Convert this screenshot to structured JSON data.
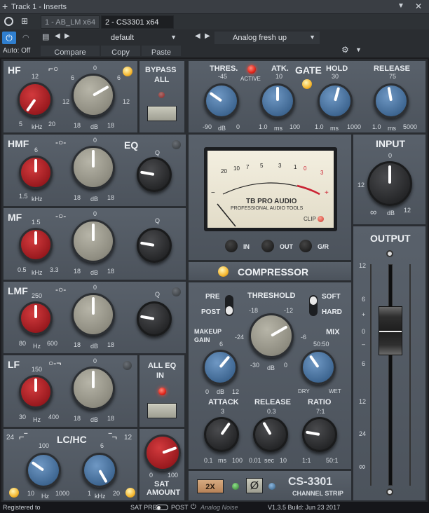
{
  "titlebar": {
    "title": "Track 1 - Inserts"
  },
  "tabs": [
    {
      "label": "1 - AB_LM x64"
    },
    {
      "label": "2 - CS3301 x64"
    }
  ],
  "preset": {
    "name": "default",
    "program": "Analog fresh up",
    "auto": "Auto: Off",
    "compare": "Compare",
    "copy": "Copy",
    "paste": "Paste"
  },
  "eq": {
    "hf": {
      "title": "HF",
      "freq_top": "12",
      "freq_lo": "5",
      "freq_hi": "20",
      "freq_unit": "kHz",
      "gain_top": "0",
      "gain_l": "6",
      "gain_r": "6",
      "gain_ll": "12",
      "gain_rr": "12",
      "gain_bl": "18",
      "gain_br": "18",
      "gain_unit": "dB"
    },
    "bypass": {
      "label1": "BYPASS",
      "label2": "ALL"
    },
    "hmf": {
      "title": "HMF",
      "eq": "EQ",
      "freq_top": "6",
      "freq_lo": "1.5",
      "freq_unit": "kHz",
      "q": "Q"
    },
    "mf": {
      "title": "MF",
      "freq_top": "1.5",
      "freq_lo": "0.5",
      "freq_hi": "3.3",
      "freq_unit": "kHz",
      "q": "Q"
    },
    "lmf": {
      "title": "LMF",
      "freq_top": "250",
      "freq_lo": "80",
      "freq_hi": "600",
      "freq_unit": "Hz",
      "q": "Q"
    },
    "lf": {
      "title": "LF",
      "freq_top": "150",
      "freq_lo": "30",
      "freq_hi": "400",
      "freq_unit": "Hz"
    },
    "alleq": {
      "label1": "ALL EQ",
      "label2": "IN"
    },
    "lchc": {
      "title": "LC/HC",
      "lc_left": "24",
      "hc_right": "12",
      "lc_top": "100",
      "lc_lo": "10",
      "lc_hi": "1000",
      "lc_unit": "Hz",
      "hc_top": "6",
      "hc_lo": "1",
      "hc_hi": "20",
      "hc_unit": "kHz"
    },
    "sat": {
      "lo": "0",
      "hi": "100",
      "label1": "SAT",
      "label2": "AMOUNT"
    }
  },
  "gate": {
    "title": "GATE",
    "thres": "THRES.",
    "thres_top": "-45",
    "thres_lo": "-90",
    "thres_hi": "0",
    "thres_unit": "dB",
    "active": "ACTIVE",
    "atk": "ATK.",
    "atk_top": "10",
    "atk_lo": "1.0",
    "atk_hi": "100",
    "atk_unit": "ms",
    "hold": "HOLD",
    "hold_top": "30",
    "hold_lo": "1.0",
    "hold_hi": "1000",
    "hold_unit": "ms",
    "release": "RELEASE",
    "rel_top": "75",
    "rel_lo": "1.0",
    "rel_hi": "5000",
    "rel_unit": "ms"
  },
  "meter": {
    "brand": "TB PRO AUDIO",
    "sub": "PROFESSIONAL AUDIO TOOLS",
    "clip": "CLIP",
    "scale": [
      "20",
      "10",
      "7",
      "5",
      "3",
      "1",
      "0",
      "3"
    ],
    "minus": "−",
    "plus": "+",
    "in": "IN",
    "out": "OUT",
    "gr": "G/R"
  },
  "comp": {
    "title": "COMPRESSOR",
    "pre": "PRE",
    "post": "POST",
    "threshold": "THRESHOLD",
    "th_a": "-18",
    "th_b": "-12",
    "th_c": "-24",
    "th_d": "-6",
    "th_lo": "-30",
    "th_hi": "0",
    "th_unit": "dB",
    "soft": "SOFT",
    "hard": "HARD",
    "makeup1": "MAKEUP",
    "makeup2": "GAIN",
    "mk_top": "6",
    "mk_lo": "0",
    "mk_hi": "12",
    "mk_unit": "dB",
    "mix": "MIX",
    "mix_top": "50:50",
    "dry": "DRY",
    "wet": "WET",
    "attack": "ATTACK",
    "at_top": "3",
    "at_lo": "0.1",
    "at_hi": "100",
    "at_unit": "ms",
    "release": "RELEASE",
    "rl_top": "0.3",
    "rl_lo": "0.01",
    "rl_hi": "10",
    "rl_unit": "sec",
    "ratio": "RATIO",
    "ra_top": "7:1",
    "ra_lo": "1:1",
    "ra_hi": "50:1"
  },
  "input": {
    "title": "INPUT",
    "v0": "0",
    "v12": "12",
    "v_bl": "∞",
    "v_br": "12",
    "unit": "dB"
  },
  "output": {
    "title": "OUTPUT",
    "scale": [
      "12",
      "6",
      "+",
      "0",
      "–",
      "6",
      "12",
      "24",
      "∞"
    ]
  },
  "footer": {
    "oversample": "2X",
    "model": "CS-3301",
    "strip": "CHANNEL STRIP",
    "registered": "Registered to",
    "satpre": "SAT PRE",
    "post": "POST",
    "noise": "Analog Noise",
    "version": "V1.3.5 Build: Jun 23 2017"
  }
}
